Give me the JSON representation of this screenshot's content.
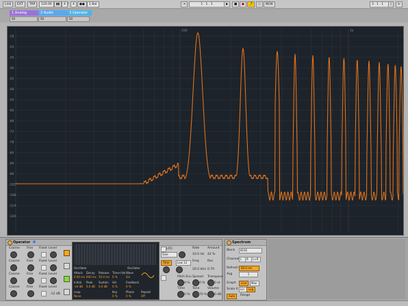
{
  "transport": {
    "link": "Link",
    "ext": "EXT",
    "tap": "TAP",
    "tempo": "120.00",
    "meter_num": "4",
    "meter_den": "4",
    "quantize": "1 Bar",
    "position": "1 . 1 . 1",
    "new_label": "NEW",
    "loop_start": "3 . 1 . 1"
  },
  "tracks": [
    {
      "name": "1 Analog",
      "color": "#9b72d9",
      "meter": "S0"
    },
    {
      "name": "2 Audio",
      "color": "#5aa8f0",
      "meter": "S0"
    },
    {
      "name": "3 Operator",
      "color": "#4fb3e8",
      "meter": "S0"
    }
  ],
  "spectrum_view": {
    "y_ticks": [
      "-18",
      "-24",
      "-30",
      "-36",
      "-42",
      "-48",
      "-54",
      "-60",
      "-66",
      "-72",
      "-78",
      "-84",
      "-90",
      "-96",
      "-102",
      "-108",
      "-114",
      "-120"
    ],
    "x_ticks": [
      "100",
      "1k"
    ],
    "curve_color": "#e0721b",
    "grid_color": "#2e363f"
  },
  "operator": {
    "title": "Operator",
    "osc_rows": [
      {
        "coarse": "Coarse",
        "fine": "Fine",
        "fixed": "Fixed",
        "level": "Level"
      },
      {
        "coarse": "Coarse",
        "fine": "Fine",
        "fixed": "Fixed",
        "level": "Level"
      },
      {
        "coarse": "Coarse",
        "fine": "Fine",
        "fixed": "Fixed",
        "level": "Level"
      },
      {
        "coarse": "Coarse",
        "fine": "Fine",
        "fixed": "Fixed",
        "level": "Level",
        "level_val": "-12 dB"
      }
    ],
    "env_mode_left": "Oscillator",
    "env_mode_right": "Oscillator",
    "attack_label": "Attack",
    "attack_val": "0.00 ms",
    "decay_label": "Decay",
    "decay_val": "600 ms",
    "release_label": "Release",
    "release_val": "50.0 ms",
    "timevel_label": "Time<Vel",
    "timevel_val": "0 %",
    "wave_label": "Wave",
    "wave_val": "Sin",
    "initial_label": "Initial",
    "initial_val": "-inf dB",
    "peak_label": "Peak",
    "peak_val": "0.0 dB",
    "sustain_label": "Sustain",
    "sustain_val": "0.0 dB",
    "vel_label": "Vel",
    "vel_val": "0 %",
    "feedback_label": "Feedback",
    "feedback_val": "0 %",
    "loop_label": "Loop",
    "loop_val": "None",
    "key_label": "Key",
    "key_val": "0 %",
    "phase_label": "Phase",
    "phase_val": "0 %",
    "repeat_label": "Repeat",
    "repeat_val": "Off",
    "lfo_label": "LFO",
    "lfo_wave": "Sine",
    "rate_label": "Rate",
    "rate_val": "10.0 Hz",
    "amount_label": "Amount",
    "amount_val": "42 %",
    "filter_label": "Filter",
    "filter_type": "Low 12",
    "freq_label": "Freq",
    "freq_val": "20.0 kHz",
    "res_label": "Res",
    "res_val": "0.70",
    "pitch_env_label": "Pitch Env",
    "spread_label": "Spread",
    "transpose_label": "Transpose",
    "pitch_env_val": "0 %",
    "spread_val": "0 %",
    "transpose_val": "0 st",
    "time_label": "Time",
    "time_val": "0 %",
    "tone_label": "Tone",
    "tone_val": "70 %",
    "volume_label": "Volume",
    "volume_val": "0 dB"
  },
  "spectrum_device": {
    "title": "Spectrum",
    "block_label": "Block",
    "block_val": "8192",
    "channel_label": "Channel",
    "channel_l": "L",
    "channel_r": "R",
    "channel_lr": "L+R",
    "refresh_label": "Refresh",
    "refresh_val": "60.0 ms",
    "avg_label": "Avg",
    "avg_val": "1",
    "graph_label": "Graph",
    "graph_line": "Line",
    "graph_max": "Max",
    "scale_label": "Scale X",
    "scale_lin": "Lin",
    "scale_log": "Log",
    "auto_label": "Auto",
    "range_label": "Range"
  }
}
